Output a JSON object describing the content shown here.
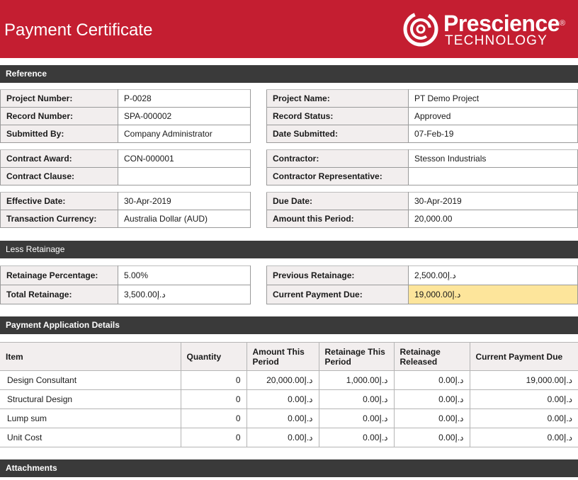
{
  "header": {
    "title": "Payment Certificate",
    "logo": {
      "brand": "Prescience",
      "reg_mark": "®",
      "sub": "TECHNOLOGY",
      "icon": "prescience-swirl-icon"
    }
  },
  "sections": {
    "reference": "Reference",
    "less_retainage": "Less Retainage",
    "payment_application": "Payment Application Details",
    "attachments": "Attachments"
  },
  "reference": {
    "group1_left": [
      {
        "label": "Project Number:",
        "value": "P-0028"
      },
      {
        "label": "Record Number:",
        "value": "SPA-000002"
      },
      {
        "label": "Submitted By:",
        "value": "Company Administrator"
      }
    ],
    "group1_right": [
      {
        "label": "Project Name:",
        "value": "PT Demo Project"
      },
      {
        "label": "Record Status:",
        "value": "Approved"
      },
      {
        "label": "Date Submitted:",
        "value": "07-Feb-19"
      }
    ],
    "group2_left": [
      {
        "label": "Contract Award:",
        "value": "CON-000001"
      },
      {
        "label": "Contract Clause:",
        "value": ""
      }
    ],
    "group2_right": [
      {
        "label": "Contractor:",
        "value": "Stesson Industrials"
      },
      {
        "label": "Contractor Representative:",
        "value": ""
      }
    ],
    "group3_left": [
      {
        "label": "Effective Date:",
        "value": "30-Apr-2019"
      },
      {
        "label": "Transaction Currency:",
        "value": "Australia Dollar (AUD)"
      }
    ],
    "group3_right": [
      {
        "label": "Due Date:",
        "value": "30-Apr-2019"
      },
      {
        "label": "Amount this Period:",
        "value": "20,000.00"
      }
    ]
  },
  "retainage": {
    "left": [
      {
        "label": "Retainage Percentage:",
        "value": "5.00%"
      },
      {
        "label": "Total Retainage:",
        "value": "3,500.00د.إ"
      }
    ],
    "right": [
      {
        "label": "Previous Retainage:",
        "value": "2,500.00د.إ"
      },
      {
        "label": "Current Payment Due:",
        "value": "19,000.00د.إ",
        "highlight_color": "#fde59b"
      }
    ]
  },
  "payment_table": {
    "columns": [
      "Item",
      "Quantity",
      "Amount This Period",
      "Retainage This Period",
      "Retainage Released",
      "Current Payment Due"
    ],
    "rows": [
      [
        "Design Consultant",
        "0",
        "20,000.00د.إ",
        "1,000.00د.إ",
        "0.00د.إ",
        "19,000.00د.إ"
      ],
      [
        "Structural Design",
        "0",
        "0.00د.إ",
        "0.00د.إ",
        "0.00د.إ",
        "0.00د.إ"
      ],
      [
        "Lump sum",
        "0",
        "0.00د.إ",
        "0.00د.إ",
        "0.00د.إ",
        "0.00د.إ"
      ],
      [
        "Unit Cost",
        "0",
        "0.00د.إ",
        "0.00د.إ",
        "0.00د.إ",
        "0.00د.إ"
      ]
    ]
  },
  "colors": {
    "header_red": "#c41e31",
    "section_bar": "#3a3a3a",
    "label_bg": "#f2eeee",
    "highlight": "#fde59b"
  }
}
